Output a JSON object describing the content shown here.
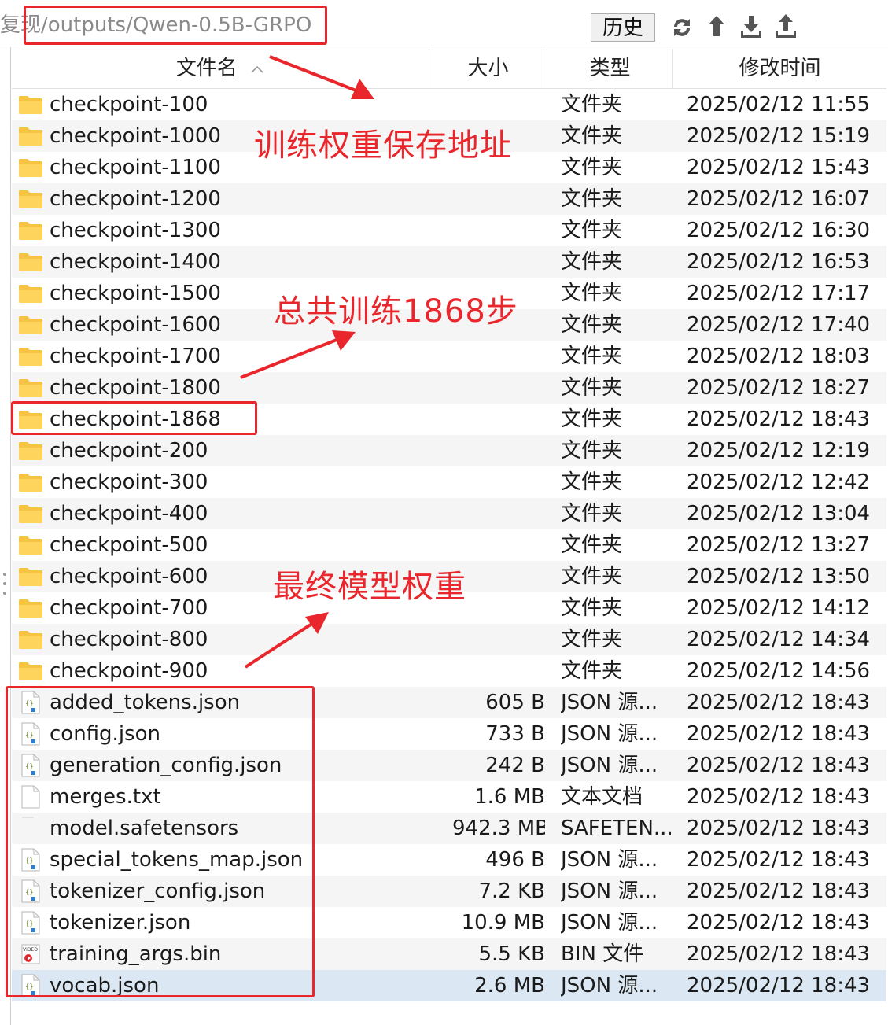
{
  "toolbar": {
    "path": "复现/outputs/Qwen-0.5B-GRPO",
    "history_label": "历史",
    "icons": [
      "refresh-icon",
      "upload-arrow-icon",
      "download-icon",
      "upload-tray-icon"
    ]
  },
  "columns": {
    "name": "文件名",
    "size": "大小",
    "type": "类型",
    "modified": "修改时间"
  },
  "rows": [
    {
      "icon": "folder",
      "name": "checkpoint-100",
      "size": "",
      "type": "文件夹",
      "modified": "2025/02/12 11:55"
    },
    {
      "icon": "folder",
      "name": "checkpoint-1000",
      "size": "",
      "type": "文件夹",
      "modified": "2025/02/12 15:19"
    },
    {
      "icon": "folder",
      "name": "checkpoint-1100",
      "size": "",
      "type": "文件夹",
      "modified": "2025/02/12 15:43"
    },
    {
      "icon": "folder",
      "name": "checkpoint-1200",
      "size": "",
      "type": "文件夹",
      "modified": "2025/02/12 16:07"
    },
    {
      "icon": "folder",
      "name": "checkpoint-1300",
      "size": "",
      "type": "文件夹",
      "modified": "2025/02/12 16:30"
    },
    {
      "icon": "folder",
      "name": "checkpoint-1400",
      "size": "",
      "type": "文件夹",
      "modified": "2025/02/12 16:53"
    },
    {
      "icon": "folder",
      "name": "checkpoint-1500",
      "size": "",
      "type": "文件夹",
      "modified": "2025/02/12 17:17"
    },
    {
      "icon": "folder",
      "name": "checkpoint-1600",
      "size": "",
      "type": "文件夹",
      "modified": "2025/02/12 17:40"
    },
    {
      "icon": "folder",
      "name": "checkpoint-1700",
      "size": "",
      "type": "文件夹",
      "modified": "2025/02/12 18:03"
    },
    {
      "icon": "folder",
      "name": "checkpoint-1800",
      "size": "",
      "type": "文件夹",
      "modified": "2025/02/12 18:27"
    },
    {
      "icon": "folder",
      "name": "checkpoint-1868",
      "size": "",
      "type": "文件夹",
      "modified": "2025/02/12 18:43"
    },
    {
      "icon": "folder",
      "name": "checkpoint-200",
      "size": "",
      "type": "文件夹",
      "modified": "2025/02/12 12:19"
    },
    {
      "icon": "folder",
      "name": "checkpoint-300",
      "size": "",
      "type": "文件夹",
      "modified": "2025/02/12 12:42"
    },
    {
      "icon": "folder",
      "name": "checkpoint-400",
      "size": "",
      "type": "文件夹",
      "modified": "2025/02/12 13:04"
    },
    {
      "icon": "folder",
      "name": "checkpoint-500",
      "size": "",
      "type": "文件夹",
      "modified": "2025/02/12 13:27"
    },
    {
      "icon": "folder",
      "name": "checkpoint-600",
      "size": "",
      "type": "文件夹",
      "modified": "2025/02/12 13:50"
    },
    {
      "icon": "folder",
      "name": "checkpoint-700",
      "size": "",
      "type": "文件夹",
      "modified": "2025/02/12 14:12"
    },
    {
      "icon": "folder",
      "name": "checkpoint-800",
      "size": "",
      "type": "文件夹",
      "modified": "2025/02/12 14:34"
    },
    {
      "icon": "folder",
      "name": "checkpoint-900",
      "size": "",
      "type": "文件夹",
      "modified": "2025/02/12 14:56"
    },
    {
      "icon": "json",
      "name": "added_tokens.json",
      "size": "605 B",
      "type": "JSON 源...",
      "modified": "2025/02/12 18:43"
    },
    {
      "icon": "json",
      "name": "config.json",
      "size": "733 B",
      "type": "JSON 源...",
      "modified": "2025/02/12 18:43"
    },
    {
      "icon": "json",
      "name": "generation_config.json",
      "size": "242 B",
      "type": "JSON 源...",
      "modified": "2025/02/12 18:43"
    },
    {
      "icon": "text",
      "name": "merges.txt",
      "size": "1.6 MB",
      "type": "文本文档",
      "modified": "2025/02/12 18:43"
    },
    {
      "icon": "blank",
      "name": "model.safetensors",
      "size": "942.3 MB",
      "type": "SAFETEN...",
      "modified": "2025/02/12 18:43"
    },
    {
      "icon": "json",
      "name": "special_tokens_map.json",
      "size": "496 B",
      "type": "JSON 源...",
      "modified": "2025/02/12 18:43"
    },
    {
      "icon": "json",
      "name": "tokenizer_config.json",
      "size": "7.2 KB",
      "type": "JSON 源...",
      "modified": "2025/02/12 18:43"
    },
    {
      "icon": "json",
      "name": "tokenizer.json",
      "size": "10.9 MB",
      "type": "JSON 源...",
      "modified": "2025/02/12 18:43"
    },
    {
      "icon": "video",
      "name": "training_args.bin",
      "size": "5.5 KB",
      "type": "BIN 文件",
      "modified": "2025/02/12 18:43"
    },
    {
      "icon": "json",
      "name": "vocab.json",
      "size": "2.6 MB",
      "type": "JSON 源...",
      "modified": "2025/02/12 18:43"
    }
  ],
  "selected_row": "vocab.json",
  "annotations": {
    "save_path": "训练权重保存地址",
    "total_steps": "总共训练1868步",
    "final_weights": "最终模型权重",
    "color": "#e8262b"
  },
  "colors": {
    "folder": "#f5c443",
    "row_alt": "#f5f5f5",
    "row_selected": "#dbe8f3",
    "annotation": "#e8262b"
  }
}
